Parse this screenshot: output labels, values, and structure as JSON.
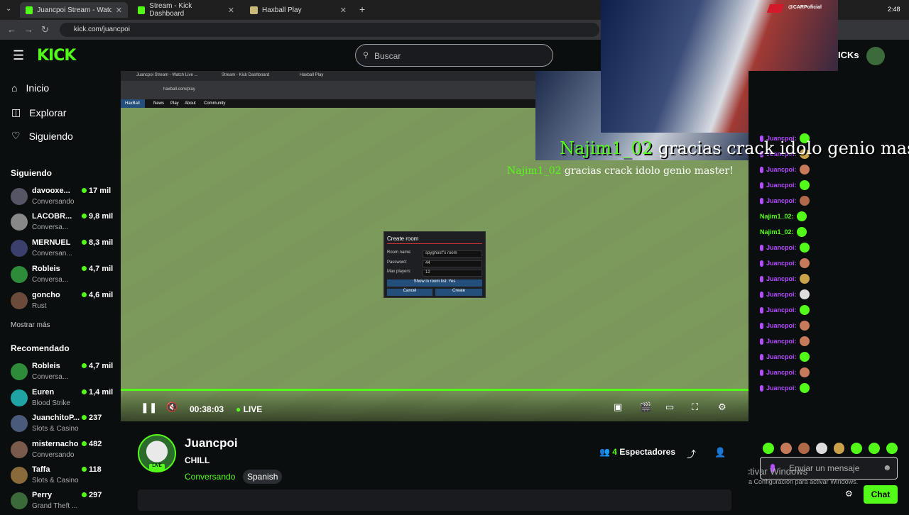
{
  "browser": {
    "tabs": [
      {
        "title": "Juancpoi Stream - Watch Live o"
      },
      {
        "title": "Stream - Kick Dashboard"
      },
      {
        "title": "Haxball Play"
      }
    ],
    "url": "kick.com/juancpoi",
    "corner_label": "@CARPoficial",
    "clock": "2:48"
  },
  "header": {
    "logo": "KICK",
    "search_placeholder": "Buscar",
    "right_partial": "ICKs"
  },
  "sidebar": {
    "nav": [
      {
        "label": "Inicio",
        "icon": "home-icon"
      },
      {
        "label": "Explorar",
        "icon": "compass-icon"
      },
      {
        "label": "Siguiendo",
        "icon": "heart-icon"
      }
    ],
    "following_title": "Siguiendo",
    "following": [
      {
        "name": "davooxe...",
        "category": "Conversando",
        "viewers": "17 mil"
      },
      {
        "name": "LACOBR...",
        "category": "Conversa...",
        "viewers": "9,8 mil"
      },
      {
        "name": "MERNUEL",
        "category": "Conversan...",
        "viewers": "8,3 mil"
      },
      {
        "name": "Robleis",
        "category": "Conversa...",
        "viewers": "4,7 mil"
      },
      {
        "name": "goncho",
        "category": "Rust",
        "viewers": "4,6 mil"
      }
    ],
    "show_more": "Mostrar más",
    "recommended_title": "Recomendado",
    "recommended": [
      {
        "name": "Robleis",
        "category": "Conversa...",
        "viewers": "4,7 mil"
      },
      {
        "name": "Euren",
        "category": "Blood Strike",
        "viewers": "1,4 mil"
      },
      {
        "name": "JuanchitoP...",
        "category": "Slots & Casino",
        "viewers": "237"
      },
      {
        "name": "misternacho",
        "category": "Conversando",
        "viewers": "482"
      },
      {
        "name": "Taffa",
        "category": "Slots & Casino",
        "viewers": "118"
      },
      {
        "name": "Perry",
        "category": "Grand Theft ...",
        "viewers": "297"
      }
    ]
  },
  "video": {
    "inner_tabs": [
      "Juancpoi Stream - Watch Live ...",
      "Stream - Kick Dashboard",
      "Haxball Play"
    ],
    "inner_url": "haxball.com/play",
    "haxball_nav": [
      "HaxBall",
      "News",
      "Play",
      "About",
      "Community"
    ],
    "dialog": {
      "title": "Create room",
      "room_name_label": "Room name:",
      "room_name_value": "spyghost''s room",
      "password_label": "Password:",
      "password_value": "44",
      "max_players_label": "Max players:",
      "max_players_value": "12",
      "show_in_list": "Show in room list: Yes",
      "cancel": "Cancel",
      "create": "Create"
    },
    "time": "00:38:03",
    "live_label": "LIVE",
    "overlay_user": "Najim1_02",
    "overlay_text": "gracias crack idolo genio master!"
  },
  "streamer": {
    "name": "Juancpoi",
    "title": "CHILL",
    "category": "Conversando",
    "language": "Spanish",
    "live_badge": "LIVE",
    "viewers": "4",
    "viewers_label": "Espectadores"
  },
  "chat": {
    "messages": [
      {
        "user": "Juancpoi:",
        "mic": true
      },
      {
        "user": "Juancpoi:",
        "mic": true
      },
      {
        "user": "Juancpoi:",
        "mic": true
      },
      {
        "user": "Juancpoi:",
        "mic": true
      },
      {
        "user": "Juancpoi:",
        "mic": true
      },
      {
        "user": "Najim1_02:",
        "mic": false
      },
      {
        "user": "Najim1_02:",
        "mic": false
      },
      {
        "user": "Juancpoi:",
        "mic": true
      },
      {
        "user": "Juancpoi:",
        "mic": true
      },
      {
        "user": "Juancpoi:",
        "mic": true
      },
      {
        "user": "Juancpoi:",
        "mic": true
      },
      {
        "user": "Juancpoi:",
        "mic": true
      },
      {
        "user": "Juancpoi:",
        "mic": true
      },
      {
        "user": "Juancpoi:",
        "mic": true
      },
      {
        "user": "Juancpoi:",
        "mic": true
      },
      {
        "user": "Juancpoi:",
        "mic": true
      },
      {
        "user": "Juancpoi:",
        "mic": true
      }
    ],
    "input_placeholder": "Enviar un mensaje",
    "send_label": "Chat"
  },
  "watermark": {
    "line1": "Activar Windows",
    "line2": "Ve a Configuración para activar Windows."
  },
  "colors": {
    "brand": "#53fc18",
    "background": "#0b0e0f",
    "user_purple": "#b44cff",
    "user_green": "#53fc18"
  }
}
